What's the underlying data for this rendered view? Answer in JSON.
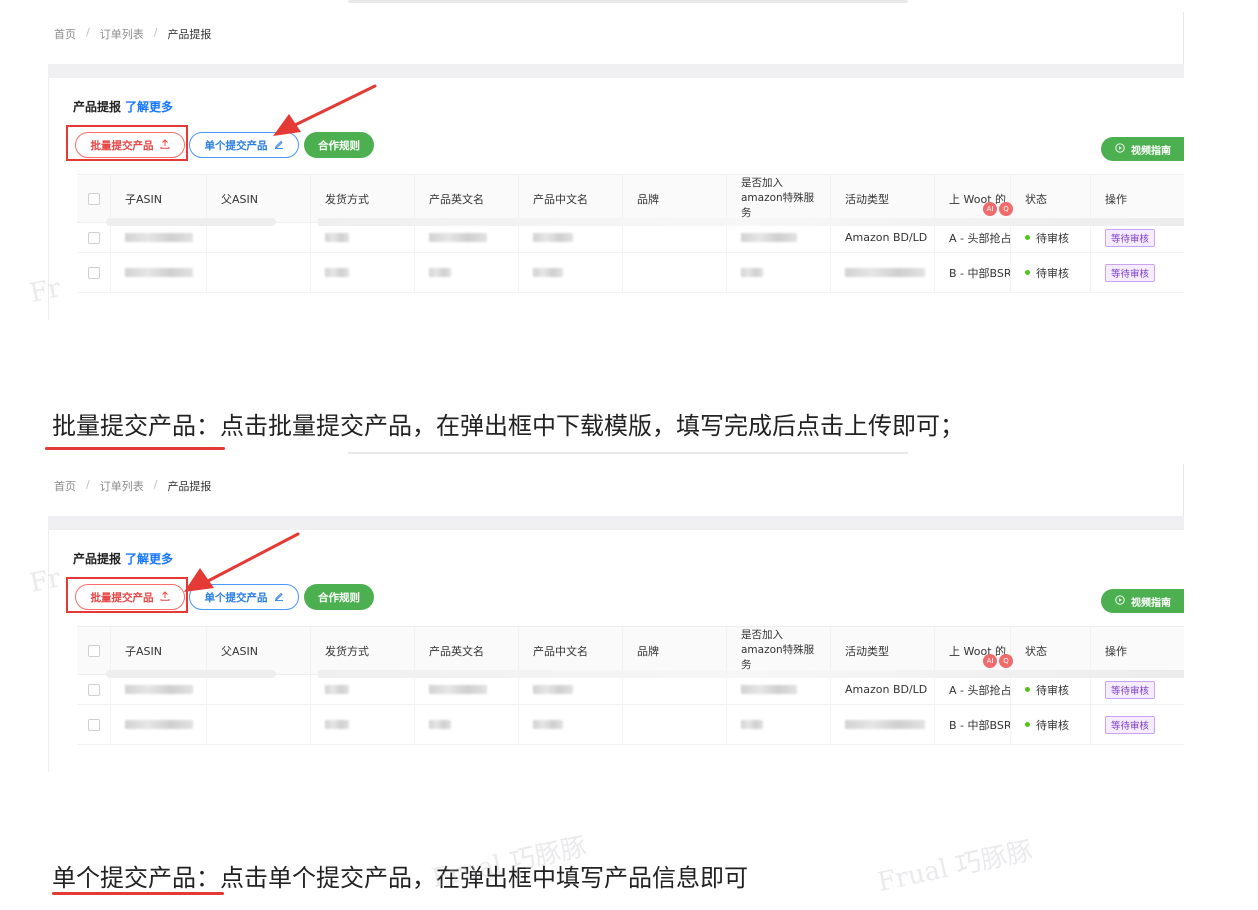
{
  "breadcrumb": {
    "home": "首页",
    "orders": "订单列表",
    "current": "产品提报"
  },
  "card": {
    "title": "产品提报",
    "learn_more": "了解更多"
  },
  "buttons": {
    "batch_submit": "批量提交产品",
    "single_submit": "单个提交产品",
    "rules": "合作规则",
    "video_guide": "视频指南"
  },
  "table": {
    "headers": [
      "子ASIN",
      "父ASIN",
      "发货方式",
      "产品英文名",
      "产品中文名",
      "品牌",
      "是否加入amazon特殊服务",
      "活动类型",
      "上 Woot 的",
      "状态",
      "操作"
    ],
    "rows": [
      {
        "activity_type": "Amazon BD/LD",
        "woot": "A - 头部抢占价",
        "status": "待审核",
        "action": "等待审核"
      },
      {
        "activity_type": "",
        "woot": "B - 中部BSR突",
        "status": "待审核",
        "action": "等待审核"
      }
    ]
  },
  "captions": {
    "batch": {
      "key": "批量提交产品",
      "text": "：点击批量提交产品，在弹出框中下载模版，填写完成后点击上传即可；"
    },
    "single": {
      "key": "单个提交产品",
      "text": "：点击单个提交产品，在弹出框中填写产品信息即可"
    }
  },
  "watermark": {
    "text": "Frual 巧豚豚",
    "short": "Fr"
  },
  "colors": {
    "danger": "#e53935",
    "primary": "#1677ff",
    "success": "#4caf50",
    "tag_purple": "#7b3fc4"
  },
  "icons": {
    "upload": "upload-icon",
    "edit": "edit-icon",
    "play": "play-circle-icon",
    "arrow": "red-arrow"
  }
}
